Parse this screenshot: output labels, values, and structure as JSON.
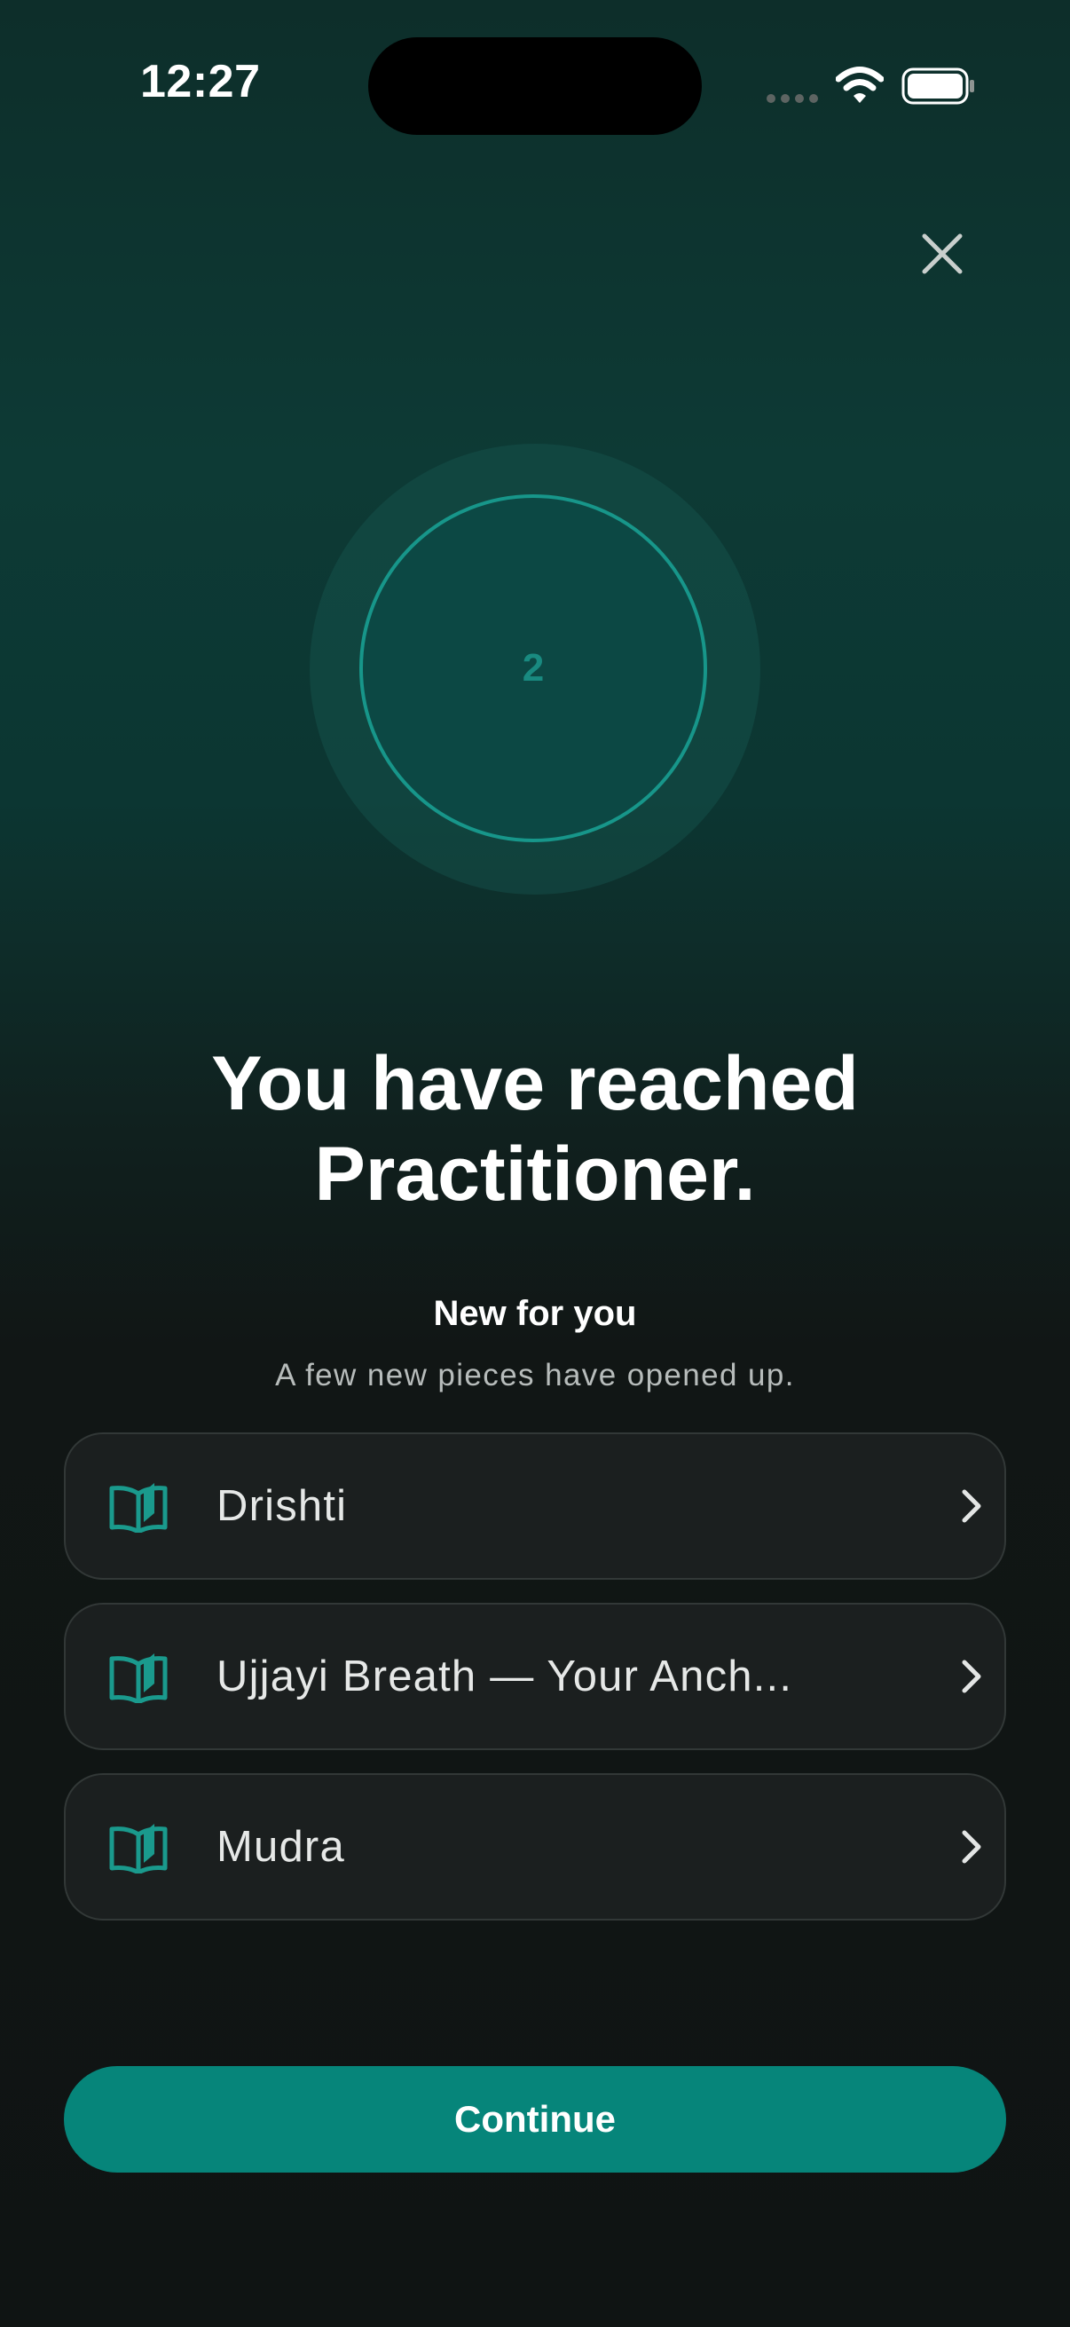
{
  "status_bar": {
    "time": "12:27"
  },
  "level": {
    "number": "2",
    "ring_color": "#17968a"
  },
  "headline": {
    "line1": "You have reached",
    "line2": "Practitioner."
  },
  "new_section": {
    "title": "New for you",
    "subtitle": "A few new pieces have opened up."
  },
  "items": [
    {
      "label": "Drishti",
      "icon": "book-open-icon"
    },
    {
      "label": "Ujjayi Breath — Your Anch...",
      "icon": "book-open-icon"
    },
    {
      "label": "Mudra",
      "icon": "book-open-icon"
    }
  ],
  "continue_button": {
    "label": "Continue"
  },
  "colors": {
    "accent": "#06857a",
    "icon_teal": "#1a9a8d",
    "card_bg": "#1b1f1f"
  }
}
